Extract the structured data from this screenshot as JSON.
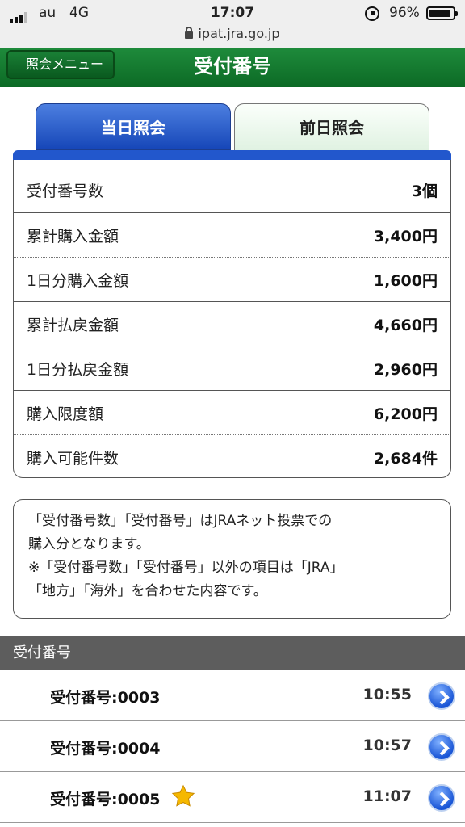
{
  "status_bar": {
    "carrier": "au",
    "network": "4G",
    "time": "17:07",
    "battery_text": "96%",
    "battery_level": 0.96,
    "url": "ipat.jra.go.jp"
  },
  "nav": {
    "back_label": "照会メニュー",
    "title": "受付番号"
  },
  "tabs": [
    {
      "label": "当日照会",
      "active": true
    },
    {
      "label": "前日照会",
      "active": false
    }
  ],
  "summary": [
    {
      "label": "受付番号数",
      "value": "3個"
    },
    {
      "label": "累計購入金額",
      "value": "3,400円"
    },
    {
      "label": "1日分購入金額",
      "value": "1,600円"
    },
    {
      "label": "累計払戻金額",
      "value": "4,660円"
    },
    {
      "label": "1日分払戻金額",
      "value": "2,960円"
    },
    {
      "label": "購入限度額",
      "value": "6,200円"
    },
    {
      "label": "購入可能件数",
      "value": "2,684件"
    }
  ],
  "notice": {
    "line1": "「受付番号数」「受付番号」はJRAネット投票での",
    "line2": "購入分となります。",
    "line3": "※「受付番号数」「受付番号」以外の項目は「JRA」",
    "line4": "「地方」「海外」を合わせた内容です。"
  },
  "list": {
    "header": "受付番号",
    "items": [
      {
        "label": "受付番号:0003",
        "time": "10:55",
        "starred": false
      },
      {
        "label": "受付番号:0004",
        "time": "10:57",
        "starred": false
      },
      {
        "label": "受付番号:0005",
        "time": "11:07",
        "starred": true
      }
    ]
  },
  "colors": {
    "nav_green": "#0c6a25",
    "tab_blue": "#2257cc",
    "list_header_gray": "#5d5d5d",
    "star_gold": "#f5b800"
  }
}
